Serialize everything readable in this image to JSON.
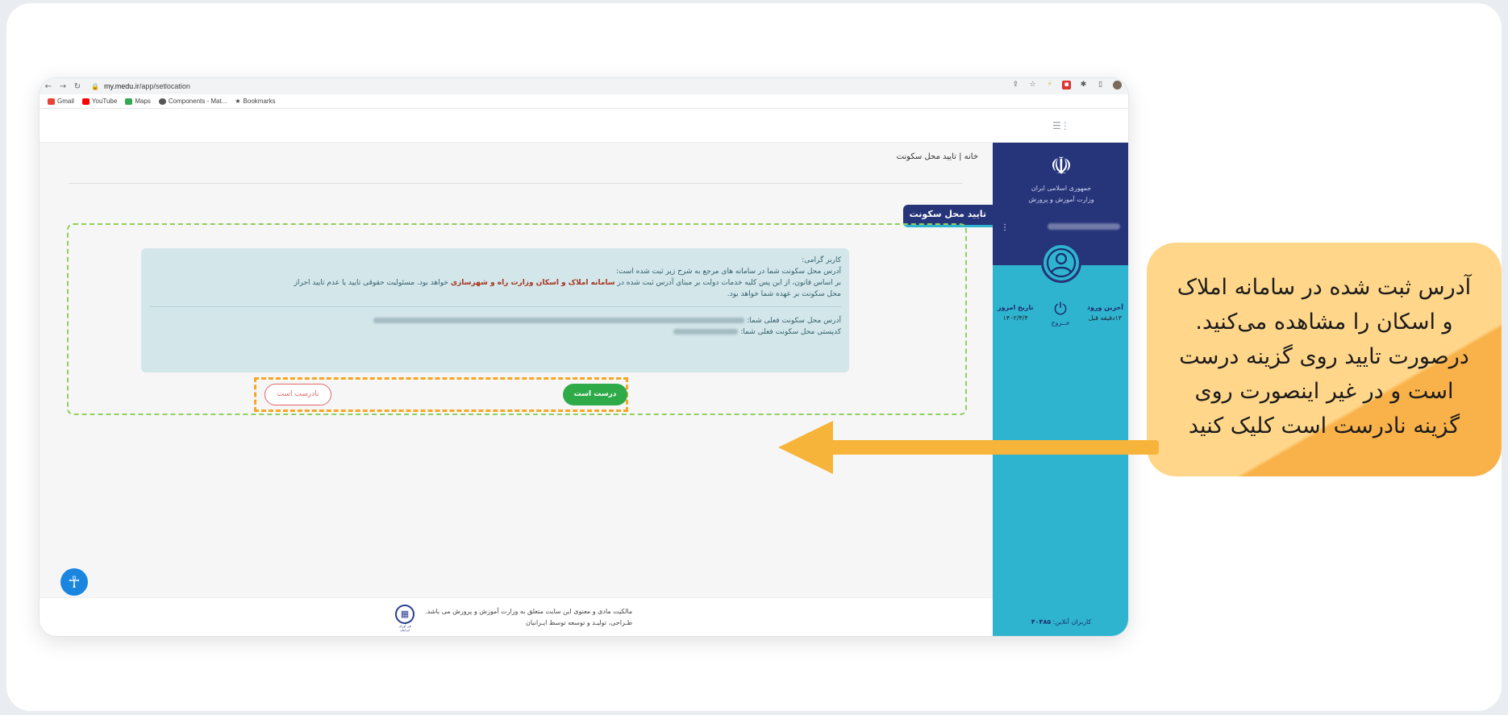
{
  "browser": {
    "url_domain": "my.medu.ir",
    "url_path": "/app/setlocation",
    "bookmarks": [
      "Gmail",
      "YouTube",
      "Maps",
      "Components - Mat...",
      "Bookmarks"
    ]
  },
  "sidebar": {
    "emblem_line1": "جمهوری اسلامی ایران",
    "emblem_line2": "وزارت آموزش و پرورش",
    "last_login_label": "آخرین ورود",
    "last_login_value": "۱۳دقیقه قبل",
    "logout_label": "خــروج",
    "today_label": "تاریخ امروز",
    "today_value": "۱۴۰۲/۴/۴",
    "online_label": "کاربران آنلاین:",
    "online_value": "۴۰۴۸۵"
  },
  "breadcrumb": {
    "home": "خانه",
    "sep": "|",
    "current": "تایید محل سکونت"
  },
  "section_title": "تایید محل سکونت",
  "notice": {
    "greeting": "کاربر گرامی:",
    "line1": "آدرس محل سکونت شما در سامانه های مرجع به شرح زیر ثبت شده است:",
    "line2_a": "بر اساس قانون، از این پس کلیه خدمات دولت بر مبنای آدرس ثبت شده در ",
    "line2_b": "سامانه املاک و اسکان وزارت راه و شهرسازی",
    "line2_c": " خواهد بود. مسئولیت حقوقی تایید یا عدم تایید احراز",
    "line3": "محل سکونت بر عهده شما خواهد بود.",
    "address_label": "آدرس محل سکونت فعلی شما:",
    "postal_label": "کدپستی محل سکونت فعلی شما:"
  },
  "buttons": {
    "ok": "درست است",
    "not_ok": "نادرست است"
  },
  "footer": {
    "line1": "مالکیت مادی و معنوی این سایت متعلق به وزارت آموزش و پرورش می باشد.",
    "line2": "طـراحی، تولیـد و توسعه توسط ایـرانیان",
    "logo_text": "فن آوران ایرانیان"
  },
  "callout": {
    "lines": [
      "آدرس ثبت شده در سامانه املاک",
      "و اسکان را مشاهده می‌کنید.",
      "درصورت تایید روی  گزینه درست",
      "است و در غیر اینصورت روی",
      "گزینه نادرست است کلیک کنید"
    ]
  },
  "colors": {
    "accent_navy": "#26357a",
    "sidebar_cyan": "#2fb4cf",
    "ok_green": "#2eaa48",
    "callout_yellow": "#ffd68a",
    "arrow_orange": "#f7b43b"
  }
}
